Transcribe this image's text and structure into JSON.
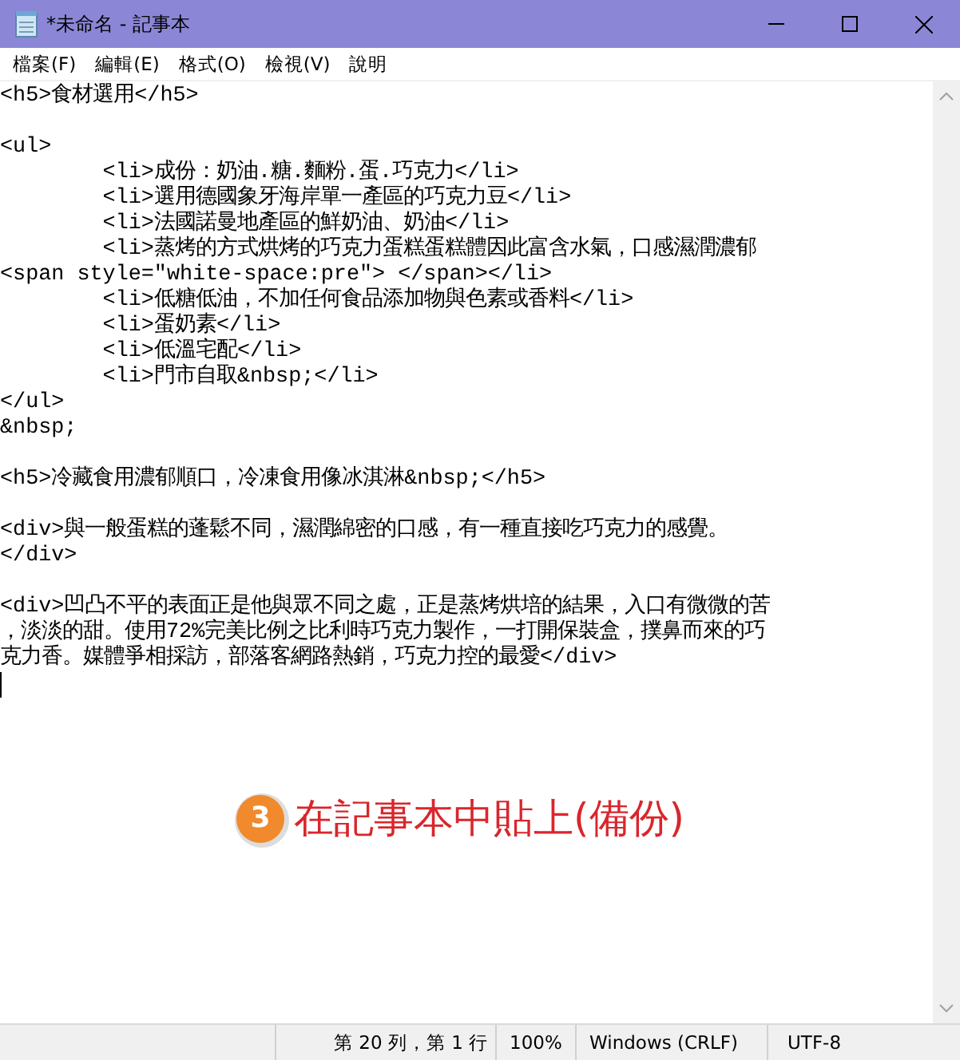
{
  "window": {
    "title": "*未命名 - 記事本"
  },
  "menu": [
    "檔案(F)",
    "編輯(E)",
    "格式(O)",
    "檢視(V)",
    "說明"
  ],
  "lines": [
    {
      "kind": "text",
      "text": "<h5>食材選用</h5>"
    },
    {
      "kind": "blank"
    },
    {
      "kind": "text",
      "text": "<ul>"
    },
    {
      "kind": "text",
      "text": "\t<li>成份：奶油.糖.麵粉.蛋.巧克力</li>"
    },
    {
      "kind": "text",
      "text": "\t<li>選用德國象牙海岸單一產區的巧克力豆</li>"
    },
    {
      "kind": "text",
      "text": "\t<li>法國諾曼地產區的鮮奶油、奶油</li>"
    },
    {
      "kind": "text",
      "text": "\t<li>蒸烤的方式烘烤的巧克力蛋糕蛋糕體因此富含水氣，口感濕潤濃郁"
    },
    {
      "kind": "text",
      "text": "<span style=\"white-space:pre\"> </span></li>"
    },
    {
      "kind": "text",
      "text": "\t<li>低糖低油，不加任何食品添加物與色素或香料</li>"
    },
    {
      "kind": "text",
      "text": "\t<li>蛋奶素</li>"
    },
    {
      "kind": "text",
      "text": "\t<li>低溫宅配</li>"
    },
    {
      "kind": "text",
      "text": "\t<li>門市自取&nbsp;</li>"
    },
    {
      "kind": "text",
      "text": "</ul>"
    },
    {
      "kind": "text",
      "text": "&nbsp;"
    },
    {
      "kind": "blank"
    },
    {
      "kind": "text",
      "text": "<h5>冷藏食用濃郁順口，冷凍食用像冰淇淋&nbsp;</h5>"
    },
    {
      "kind": "blank"
    },
    {
      "kind": "text",
      "text": "<div>與一般蛋糕的蓬鬆不同，濕潤綿密的口感，有一種直接吃巧克力的感覺。"
    },
    {
      "kind": "text",
      "text": "</div>"
    },
    {
      "kind": "blank"
    },
    {
      "kind": "text",
      "text": "<div>凹凸不平的表面正是他與眾不同之處，正是蒸烤烘培的結果，入口有微微的苦"
    },
    {
      "kind": "text",
      "text": "，淡淡的甜。使用72%完美比例之比利時巧克力製作，一打開保裝盒，撲鼻而來的巧"
    },
    {
      "kind": "text",
      "text": "克力香。媒體爭相採訪，部落客網路熱銷，巧克力控的最愛</div>"
    },
    {
      "kind": "caret"
    }
  ],
  "annotation": {
    "number": "3",
    "text": "在記事本中貼上(備份)"
  },
  "status_bar": [
    "第 20 列，第 1 行",
    "100%",
    "Windows (CRLF)",
    "UTF-8"
  ]
}
